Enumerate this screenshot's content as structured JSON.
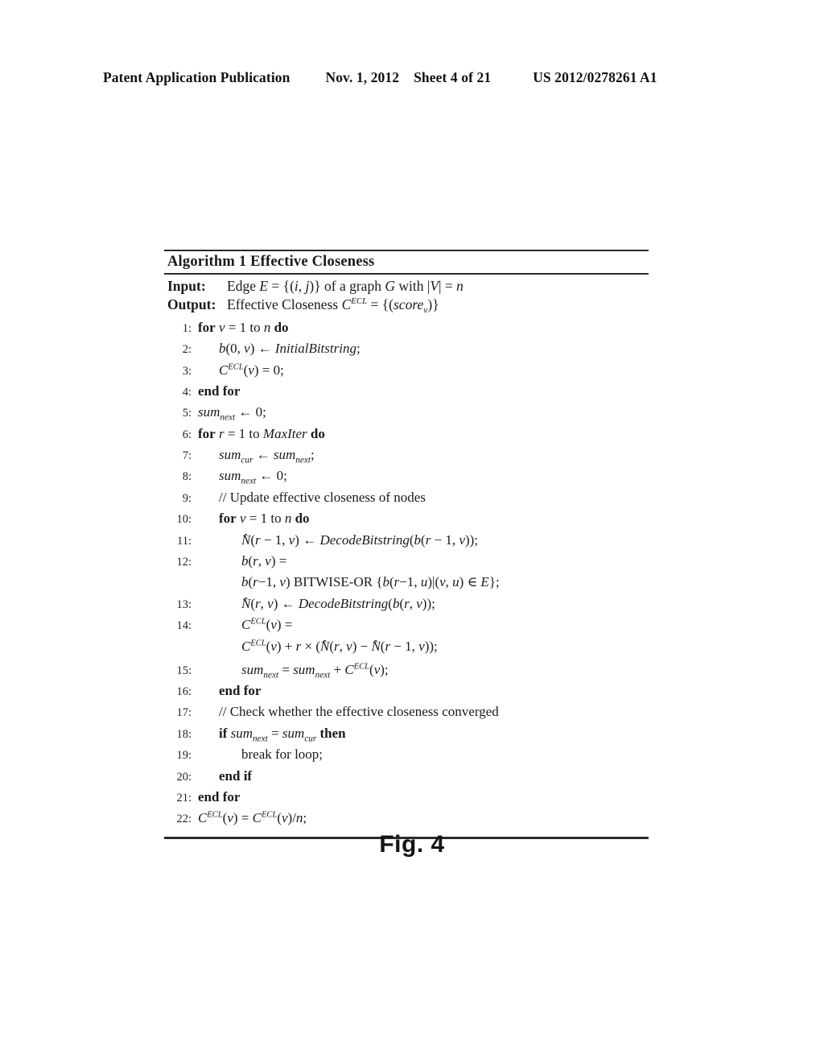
{
  "header": {
    "publication": "Patent Application Publication",
    "date": "Nov. 1, 2012",
    "sheet": "Sheet 4 of 21",
    "patent_number": "US 2012/0278261 A1"
  },
  "algorithm": {
    "title_label": "Algorithm 1",
    "title_name": "Effective Closeness",
    "input_label": "Input:",
    "input_text": "Edge E = {(i, j)} of a graph G with |V| = n",
    "output_label": "Output:",
    "output_text": "Effective Closeness C^ECL = {(score_v)}",
    "lines": [
      {
        "n": "1",
        "indent": 0,
        "text": "for v = 1 to n do"
      },
      {
        "n": "2",
        "indent": 1,
        "text": "b(0, v) ← InitialBitstring;"
      },
      {
        "n": "3",
        "indent": 1,
        "text": "C^ECL(v) = 0;"
      },
      {
        "n": "4",
        "indent": 0,
        "text": "end for"
      },
      {
        "n": "5",
        "indent": 0,
        "text": "sum_next ← 0;"
      },
      {
        "n": "6",
        "indent": 0,
        "text": "for r = 1 to MaxIter do"
      },
      {
        "n": "7",
        "indent": 1,
        "text": "sum_cur ← sum_next;"
      },
      {
        "n": "8",
        "indent": 1,
        "text": "sum_next ← 0;"
      },
      {
        "n": "9",
        "indent": 1,
        "text": "// Update effective closeness of nodes"
      },
      {
        "n": "10",
        "indent": 1,
        "text": "for v = 1 to n do"
      },
      {
        "n": "11",
        "indent": 2,
        "text": "N̂(r − 1, v) ← DecodeBitstring(b(r − 1, v));"
      },
      {
        "n": "12",
        "indent": 2,
        "text": "b(r, v) ="
      },
      {
        "n": "",
        "indent": 2,
        "text": "b(r−1, v) BITWISE-OR {b(r−1, u)|(v, u) ∈ E};"
      },
      {
        "n": "13",
        "indent": 2,
        "text": "N̂(r, v) ← DecodeBitstring(b(r, v));"
      },
      {
        "n": "14",
        "indent": 2,
        "text": "C^ECL(v) ="
      },
      {
        "n": "",
        "indent": 2,
        "text": "C^ECL(v) + r × (N̂(r, v) − N̂(r − 1, v));"
      },
      {
        "n": "15",
        "indent": 2,
        "text": "sum_next = sum_next + C^ECL(v);"
      },
      {
        "n": "16",
        "indent": 1,
        "text": "end for"
      },
      {
        "n": "17",
        "indent": 1,
        "text": "// Check whether the effective closeness converged"
      },
      {
        "n": "18",
        "indent": 1,
        "text": "if sum_next = sum_cur then"
      },
      {
        "n": "19",
        "indent": 2,
        "text": "break for loop;"
      },
      {
        "n": "20",
        "indent": 1,
        "text": "end if"
      },
      {
        "n": "21",
        "indent": 0,
        "text": "end for"
      },
      {
        "n": "22",
        "indent": 0,
        "text": "C^ECL(v) = C^ECL(v)/n;"
      }
    ]
  },
  "figure": {
    "caption": "Fig. 4"
  }
}
